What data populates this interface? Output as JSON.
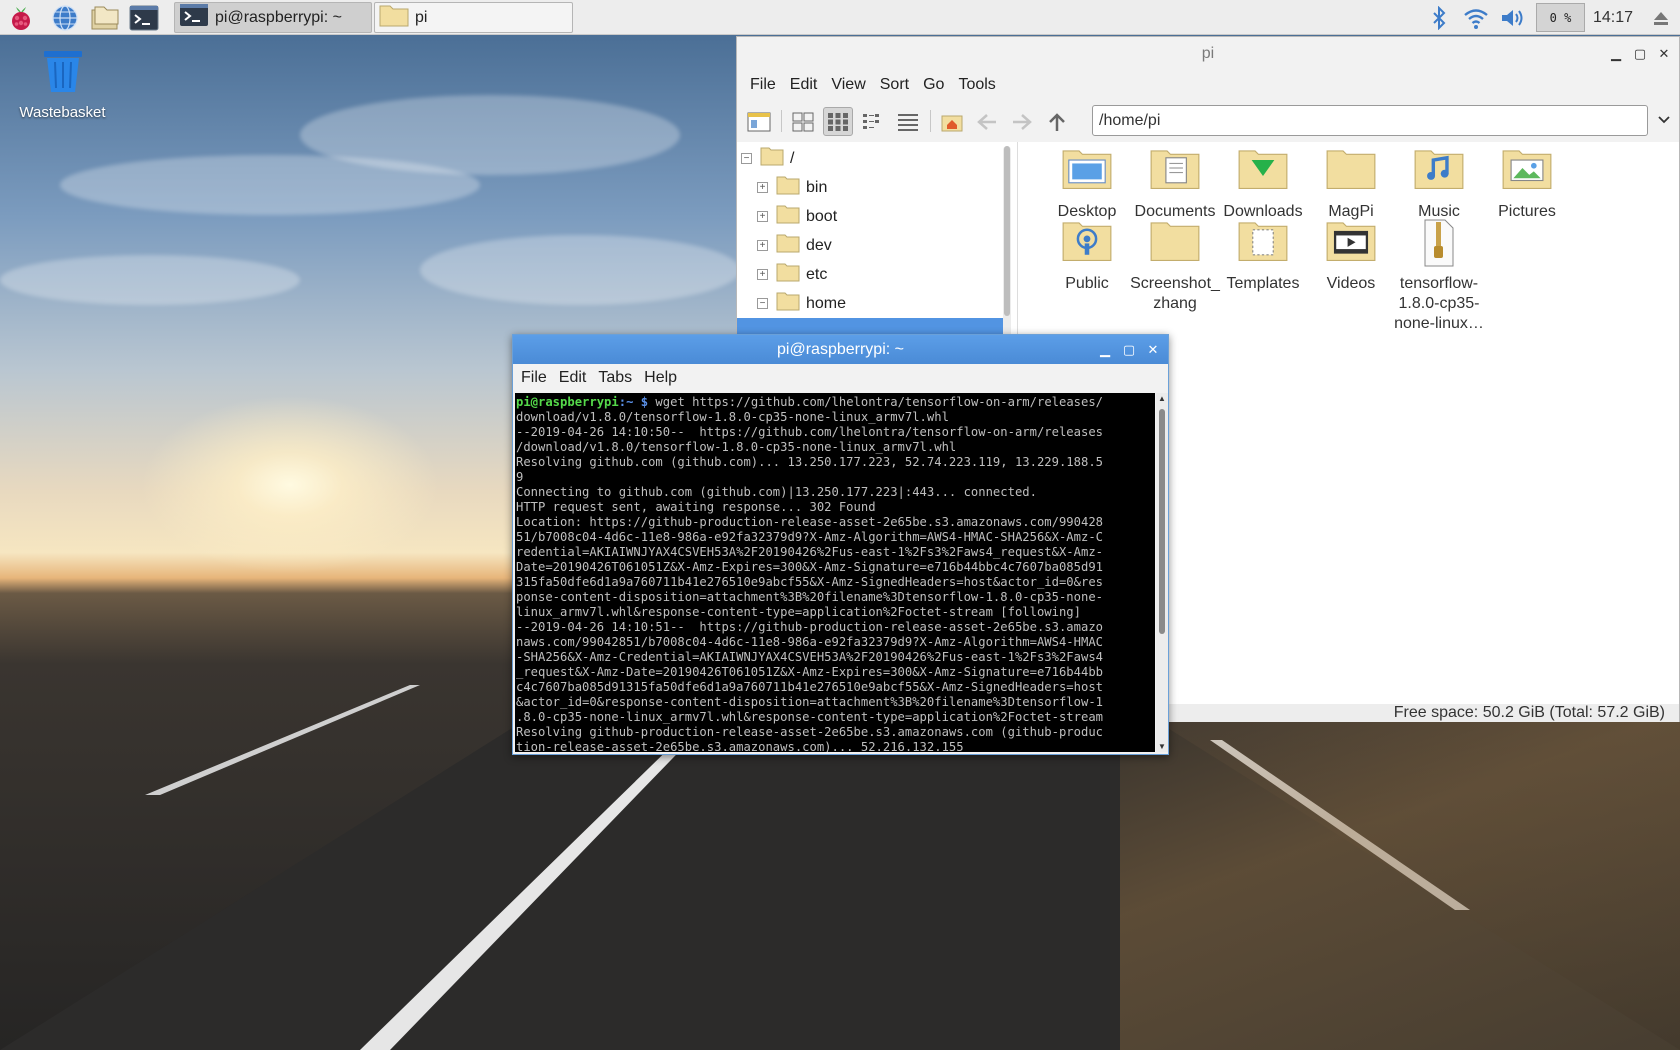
{
  "taskbar": {
    "launchers": [
      {
        "name": "raspberry-menu-icon"
      },
      {
        "name": "web-browser-icon"
      },
      {
        "name": "file-manager-icon"
      },
      {
        "name": "terminal-icon"
      }
    ],
    "tasks": [
      {
        "label": "pi@raspberrypi: ~",
        "icon": "terminal-icon",
        "active": true
      },
      {
        "label": "pi",
        "icon": "folder-icon",
        "active": false
      }
    ],
    "cpu_usage": "0 %",
    "clock": "14:17",
    "tray_icons": [
      "bluetooth-icon",
      "wifi-icon",
      "volume-icon",
      "eject-icon"
    ]
  },
  "desktop": {
    "icons": [
      {
        "label": "Wastebasket",
        "icon": "trash-icon"
      }
    ]
  },
  "file_manager": {
    "title": "pi",
    "menu": [
      "File",
      "Edit",
      "View",
      "Sort",
      "Go",
      "Tools"
    ],
    "path": "/home/pi",
    "tree": [
      {
        "label": "/",
        "expander": "−"
      },
      {
        "label": "bin",
        "expander": "+"
      },
      {
        "label": "boot",
        "expander": "+"
      },
      {
        "label": "dev",
        "expander": "+"
      },
      {
        "label": "etc",
        "expander": "+"
      },
      {
        "label": "home",
        "expander": "−"
      }
    ],
    "items": [
      {
        "label": "Desktop",
        "icon": "desktop-folder-icon"
      },
      {
        "label": "Documents",
        "icon": "documents-folder-icon"
      },
      {
        "label": "Downloads",
        "icon": "downloads-folder-icon"
      },
      {
        "label": "MagPi",
        "icon": "folder-icon"
      },
      {
        "label": "Music",
        "icon": "music-folder-icon"
      },
      {
        "label": "Pictures",
        "icon": "pictures-folder-icon"
      },
      {
        "label": "Public",
        "icon": "public-folder-icon"
      },
      {
        "label": "Screenshot_\nzhang",
        "icon": "folder-icon"
      },
      {
        "label": "Templates",
        "icon": "templates-folder-icon"
      },
      {
        "label": "Videos",
        "icon": "videos-folder-icon"
      },
      {
        "label": "tensorflow-\n1.8.0-cp35-\nnone-linux…",
        "icon": "archive-file-icon"
      }
    ],
    "status": "Free space: 50.2 GiB (Total: 57.2 GiB)"
  },
  "terminal": {
    "title": "pi@raspberrypi: ~",
    "menu": [
      "File",
      "Edit",
      "Tabs",
      "Help"
    ],
    "prompt_user": "pi@raspberrypi",
    "prompt_dir": ":~ $",
    "command": " wget https://github.com/lhelontra/tensorflow-on-arm/releases/",
    "output": "download/v1.8.0/tensorflow-1.8.0-cp35-none-linux_armv7l.whl\n--2019-04-26 14:10:50--  https://github.com/lhelontra/tensorflow-on-arm/releases\n/download/v1.8.0/tensorflow-1.8.0-cp35-none-linux_armv7l.whl\nResolving github.com (github.com)... 13.250.177.223, 52.74.223.119, 13.229.188.5\n9\nConnecting to github.com (github.com)|13.250.177.223|:443... connected.\nHTTP request sent, awaiting response... 302 Found\nLocation: https://github-production-release-asset-2e65be.s3.amazonaws.com/990428\n51/b7008c04-4d6c-11e8-986a-e92fa32379d9?X-Amz-Algorithm=AWS4-HMAC-SHA256&X-Amz-C\nredential=AKIAIWNJYAX4CSVEH53A%2F20190426%2Fus-east-1%2Fs3%2Faws4_request&X-Amz-\nDate=20190426T061051Z&X-Amz-Expires=300&X-Amz-Signature=e716b44bbc4c7607ba085d91\n315fa50dfe6d1a9a760711b41e276510e9abcf55&X-Amz-SignedHeaders=host&actor_id=0&res\nponse-content-disposition=attachment%3B%20filename%3Dtensorflow-1.8.0-cp35-none-\nlinux_armv7l.whl&response-content-type=application%2Foctet-stream [following]\n--2019-04-26 14:10:51--  https://github-production-release-asset-2e65be.s3.amazo\nnaws.com/99042851/b7008c04-4d6c-11e8-986a-e92fa32379d9?X-Amz-Algorithm=AWS4-HMAC\n-SHA256&X-Amz-Credential=AKIAIWNJYAX4CSVEH53A%2F20190426%2Fus-east-1%2Fs3%2Faws4\n_request&X-Amz-Date=20190426T061051Z&X-Amz-Expires=300&X-Amz-Signature=e716b44bb\nc4c7607ba085d91315fa50dfe6d1a9a760711b41e276510e9abcf55&X-Amz-SignedHeaders=host\n&actor_id=0&response-content-disposition=attachment%3B%20filename%3Dtensorflow-1\n.8.0-cp35-none-linux_armv7l.whl&response-content-type=application%2Foctet-stream\nResolving github-production-release-asset-2e65be.s3.amazonaws.com (github-produc\ntion-release-asset-2e65be.s3.amazonaws.com)... 52.216.132.155"
  },
  "colors": {
    "terminal_titlebar": "#5294e2",
    "prompt_user": "#55d94a",
    "prompt_dir": "#5a8fe6",
    "folder": "#f2dea0"
  }
}
